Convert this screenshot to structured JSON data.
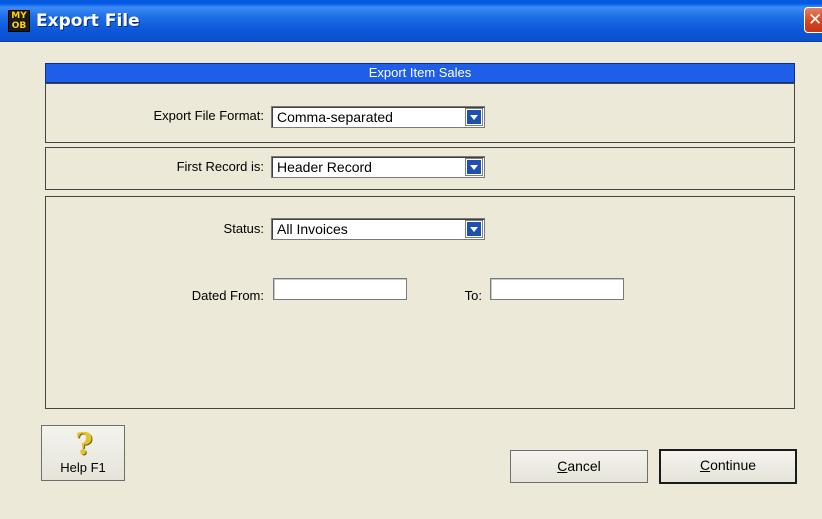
{
  "window": {
    "title": "Export File",
    "app_icon_text": [
      "MY",
      "OB"
    ],
    "close_glyph": "✕"
  },
  "header": {
    "title": "Export Item Sales"
  },
  "format": {
    "label": "Export File Format:",
    "selected": "Comma-separated"
  },
  "first_record": {
    "label": "First Record is:",
    "selected": "Header Record"
  },
  "filters": {
    "status_label": "Status:",
    "status_selected": "All Invoices",
    "dated_from_label": "Dated From:",
    "dated_from_value": "",
    "to_label": "To:",
    "to_value": ""
  },
  "buttons": {
    "help_label": "Help F1",
    "help_glyph": "?",
    "cancel_accel": "C",
    "cancel_rest": "ancel",
    "continue_accel": "C",
    "continue_rest": "ontinue"
  },
  "colors": {
    "accent_header": "#1e5ee8",
    "titlebar": "#0c57d8",
    "close": "#d6461f",
    "background": "#ece9d8"
  },
  "icons": {
    "app": "myob-logo-icon",
    "close": "close-icon",
    "help": "question-mark-icon",
    "dropdown": "chevron-down-icon"
  }
}
